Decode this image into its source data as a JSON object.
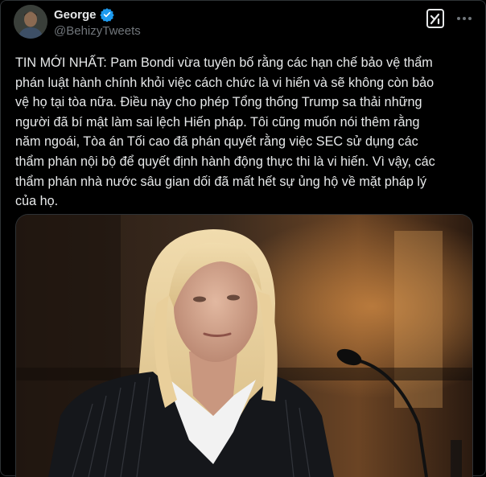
{
  "author": {
    "display_name": "George",
    "handle": "@BehizyTweets",
    "verified": true,
    "verified_color": "#1d9bf0",
    "avatar_icon": "avatar-photo"
  },
  "actions": {
    "grok_icon": "grok-icon",
    "more_icon": "more-horizontal-icon"
  },
  "tweet": {
    "text": "TIN MỚI NHẤT: Pam Bondi vừa tuyên bố rằng các hạn chế bảo vệ thẩm\nphán luật hành chính khỏi việc cách chức là vi hiến và sẽ không còn bảo\nvệ họ tại tòa nữa. Điều này cho phép Tổng thống Trump sa thải những\nngười đã bí mật làm sai lệch Hiến pháp. Tôi cũng muốn nói thêm rằng\nnăm ngoái, Tòa án Tối cao đã phán quyết rằng việc SEC sử dụng các\nthẩm phán nội bộ để quyết định hành động thực thi là vi hiến. Vì vậy, các\nthẩm phán nhà nước sâu gian dối đã mất hết sự ủng hộ về mặt pháp lý\ncủa họ."
  },
  "media": {
    "type": "photo",
    "icon": "photo-woman-at-microphone"
  },
  "colors": {
    "background": "#000000",
    "text": "#e7e9ea",
    "secondary_text": "#71767b",
    "border": "#2f3336"
  }
}
